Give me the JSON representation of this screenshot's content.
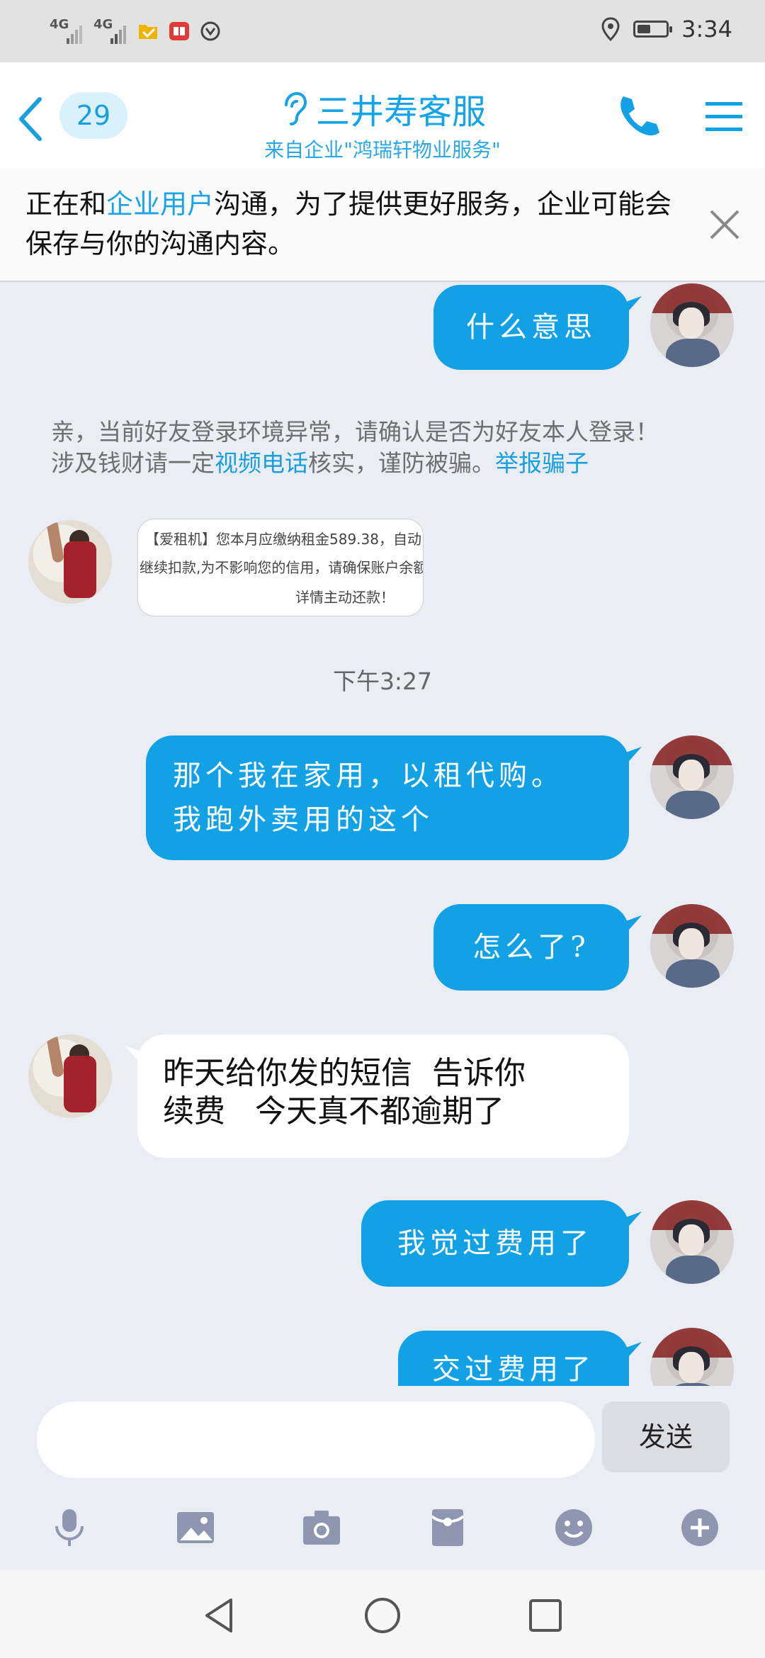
{
  "status_bar": {
    "signal1": "4G",
    "signal2": "4G",
    "time": "3:34"
  },
  "header": {
    "unread_count": "29",
    "title": "三井寿客服",
    "subtitle": "来自企业\"鸿瑞轩物业服务\""
  },
  "notice": {
    "part1": "正在和",
    "highlight": "企业用户",
    "part2": "沟通，为了提供更好服务，企业可能会保存与你的沟通内容。"
  },
  "chat": {
    "msg1": "什么意思",
    "system_line1": "亲，当前好友登录环境异常，请确认是否为好友本人登录！",
    "system_line2_a": "涉及钱财请一定",
    "system_link1": "视频电话",
    "system_line2_b": "核实，谨防被骗。",
    "system_link2": "举报骗子",
    "image_text_l1": "【爱租机】您本月应缴纳租金589.38，自动",
    "image_text_l2": "继续扣款,为不影响您的信用，请确保账户余额",
    "image_text_l3": "详情主动还款！",
    "timestamp": "下午3:27",
    "msg2_line1": "那个我在家用，以租代购。",
    "msg2_line2": "我跑外卖用的这个",
    "msg3": "怎么了?",
    "msg4_line1": "昨天给你发的短信  告诉你",
    "msg4_line2": "续费   今天真不都逾期了",
    "msg5": "我觉过费用了",
    "msg6": "交过费用了"
  },
  "input": {
    "placeholder": "",
    "send_label": "发送"
  },
  "colors": {
    "accent": "#12a1e4",
    "background": "#ebedf5"
  }
}
